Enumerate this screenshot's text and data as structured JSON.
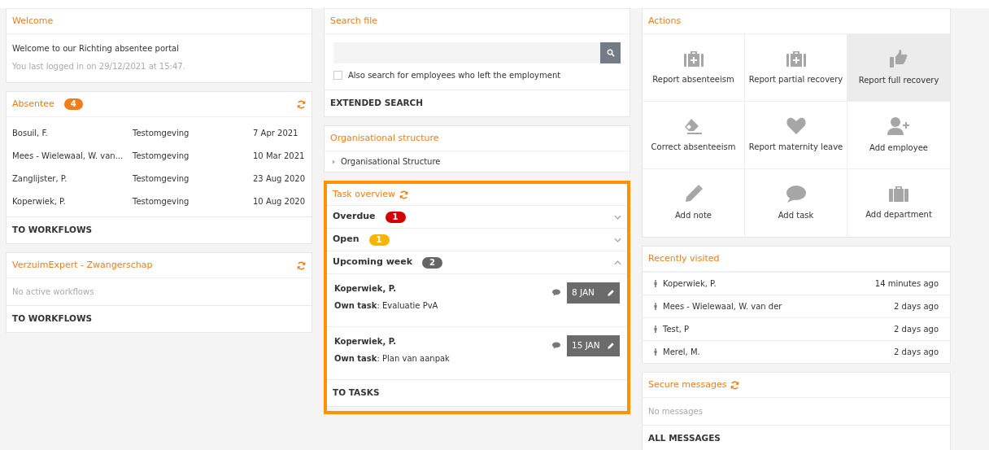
{
  "welcome": {
    "title": "Welcome",
    "message": "Welcome to our Richting absentee portal",
    "last_login": "You last logged in on 29/12/2021 at 15:47."
  },
  "absentee": {
    "title": "Absentee",
    "count": "4",
    "color": "#f07d1a",
    "rows": [
      {
        "name": "Bosuil, F.",
        "location": "Testomgeving",
        "date": "7 Apr 2021"
      },
      {
        "name": "Mees - Wielewaal, W. van...",
        "location": "Testomgeving",
        "date": "10 Mar 2021"
      },
      {
        "name": "Zanglijster, P.",
        "location": "Testomgeving",
        "date": "23 Aug 2020"
      },
      {
        "name": "Koperwiek, P.",
        "location": "Testomgeving",
        "date": "10 Aug 2020"
      }
    ],
    "footer": "TO WORKFLOWS"
  },
  "workflows": {
    "title": "VerzuimExpert - Zwangerschap",
    "empty": "No active workflows",
    "footer": "TO WORKFLOWS"
  },
  "search": {
    "title": "Search file",
    "checkbox": {
      "label": "Also search for employees who left the employment",
      "checked": false
    },
    "footer": "EXTENDED SEARCH"
  },
  "organisation": {
    "title": "Organisational structure",
    "items": [
      {
        "label": "Organisational Structure",
        "expanded": false
      }
    ]
  },
  "tasks": {
    "title": "Task overview",
    "groups": [
      {
        "label": "Overdue",
        "count": "1",
        "color": "#d40000",
        "expanded": false
      },
      {
        "label": "Open",
        "count": "1",
        "color": "#f7b500",
        "expanded": false
      },
      {
        "label": "Upcoming week",
        "count": "2",
        "color": "#666666",
        "expanded": true,
        "tasks": [
          {
            "name": "Koperwiek, P.",
            "detail": "**Own task**: Evaluatie PvA",
            "date": "8 JAN"
          },
          {
            "name": "Koperwiek, P.",
            "detail": "**Own task**: Plan van aanpak",
            "date": "15 JAN"
          }
        ]
      }
    ],
    "footer": "TO TASKS"
  },
  "actions": {
    "title": "Actions",
    "items": [
      {
        "label": "Report absenteeism",
        "selected": false
      },
      {
        "label": "Report partial recovery",
        "selected": false
      },
      {
        "label": "Report full recovery",
        "selected": true
      },
      {
        "label": "Correct absenteeism",
        "selected": false
      },
      {
        "label": "Report maternity leave",
        "selected": false
      },
      {
        "label": "Add employee",
        "selected": false
      },
      {
        "label": "Add note",
        "selected": false
      },
      {
        "label": "Add task",
        "selected": false
      },
      {
        "label": "Add department",
        "selected": false
      }
    ]
  },
  "recently_visited": {
    "title": "Recently visited",
    "items": [
      {
        "name": "Koperwiek, P.",
        "time": "14 minutes ago"
      },
      {
        "name": "Mees - Wielewaal, W. van der",
        "time": "2 days ago"
      },
      {
        "name": "Test, P",
        "time": "2 days ago"
      },
      {
        "name": "Merel, M.",
        "time": "2 days ago"
      }
    ]
  },
  "messages": {
    "title": "Secure messages",
    "empty": "No messages",
    "footer": "ALL MESSAGES"
  }
}
